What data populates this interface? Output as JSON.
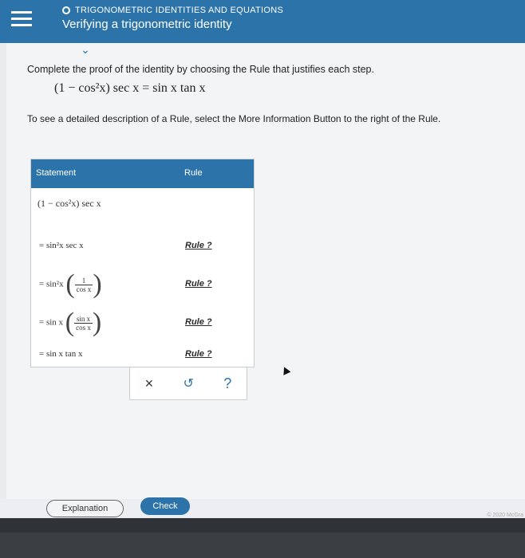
{
  "header": {
    "topic": "TRIGONOMETRIC IDENTITIES AND EQUATIONS",
    "title": "Verifying a trigonometric identity"
  },
  "main": {
    "collapse_glyph": "⌄",
    "instruction": "Complete the proof of the identity by choosing the Rule that justifies each step.",
    "identity": "(1 − cos²x) sec x = sin x tan x",
    "hint": "To see a detailed description of a Rule, select the More Information Button to the right of the Rule."
  },
  "table": {
    "header_statement": "Statement",
    "header_rule": "Rule",
    "first_statement": "(1 − cos²x) sec x",
    "rows": [
      {
        "statement": "= sin²x sec x",
        "rule": "Rule ?"
      },
      {
        "statement": "= sin²x",
        "frac_num": "1",
        "frac_den": "cos x",
        "rule": "Rule ?"
      },
      {
        "statement": "= sin x",
        "frac_num": "sin x",
        "frac_den": "cos x",
        "rule": "Rule ?"
      },
      {
        "statement": "= sin x  tan x",
        "rule": "Rule ?"
      }
    ]
  },
  "toolbar": {
    "clear": "×",
    "undo": "↺",
    "help": "?"
  },
  "buttons": {
    "explanation": "Explanation",
    "check": "Check"
  },
  "footer": {
    "copyright": "© 2020 McGra"
  },
  "colors": {
    "accent": "#2b73a8",
    "background": "#e9ebee"
  }
}
